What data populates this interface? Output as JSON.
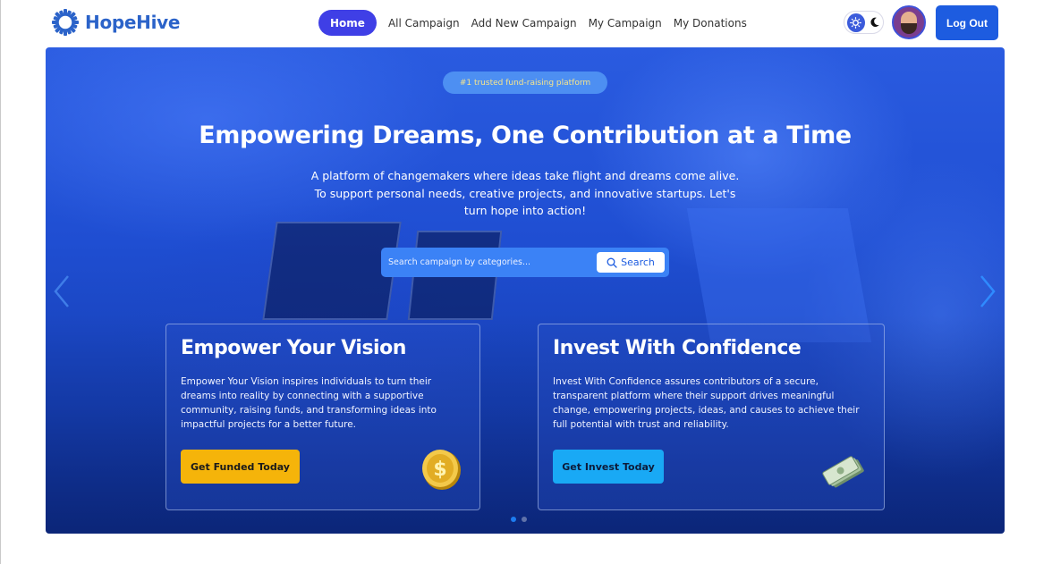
{
  "brand": {
    "name": "HopeHive",
    "logo_icon": "gear-sun-icon",
    "color": "#2b63c9"
  },
  "nav": {
    "items": [
      {
        "label": "Home",
        "active": true
      },
      {
        "label": "All Campaign",
        "active": false
      },
      {
        "label": "Add New Campaign",
        "active": false
      },
      {
        "label": "My Campaign",
        "active": false
      },
      {
        "label": "My Donations",
        "active": false
      }
    ],
    "active_color": "#3f3fe6",
    "theme_toggle": {
      "light_icon": "sun-icon",
      "dark_icon": "moon-icon"
    },
    "avatar_icon": "user-avatar",
    "logout_label": "Log Out"
  },
  "hero": {
    "badge": "#1 trusted fund-raising platform",
    "title": "Empowering Dreams, One Contribution at a Time",
    "description": "A platform of changemakers where ideas take flight and dreams come alive. To support personal needs, creative projects, and innovative startups. Let's turn hope into action!",
    "search": {
      "placeholder": "Search campaign by categories...",
      "button_label": "Search",
      "button_icon": "search-icon"
    },
    "prev_icon": "chevron-left-icon",
    "next_icon": "chevron-right-icon",
    "slides_count": 2,
    "active_slide": 1
  },
  "cards": [
    {
      "title": "Empower Your Vision",
      "text": "Empower Your Vision inspires individuals to turn their dreams into reality by connecting with a supportive community, raising funds, and transforming ideas into impactful projects for a better future.",
      "button_label": "Get Funded Today",
      "button_color": "#f5b40a",
      "icon": "gold-coin-icon"
    },
    {
      "title": "Invest With Confidence",
      "text": "Invest With Confidence assures contributors of a secure, transparent platform where their support drives meaningful change, empowering projects, ideas, and causes to achieve their full potential with trust and reliability.",
      "button_label": "Get Invest Today",
      "button_color": "#19a9f5",
      "icon": "money-stack-icon"
    }
  ]
}
